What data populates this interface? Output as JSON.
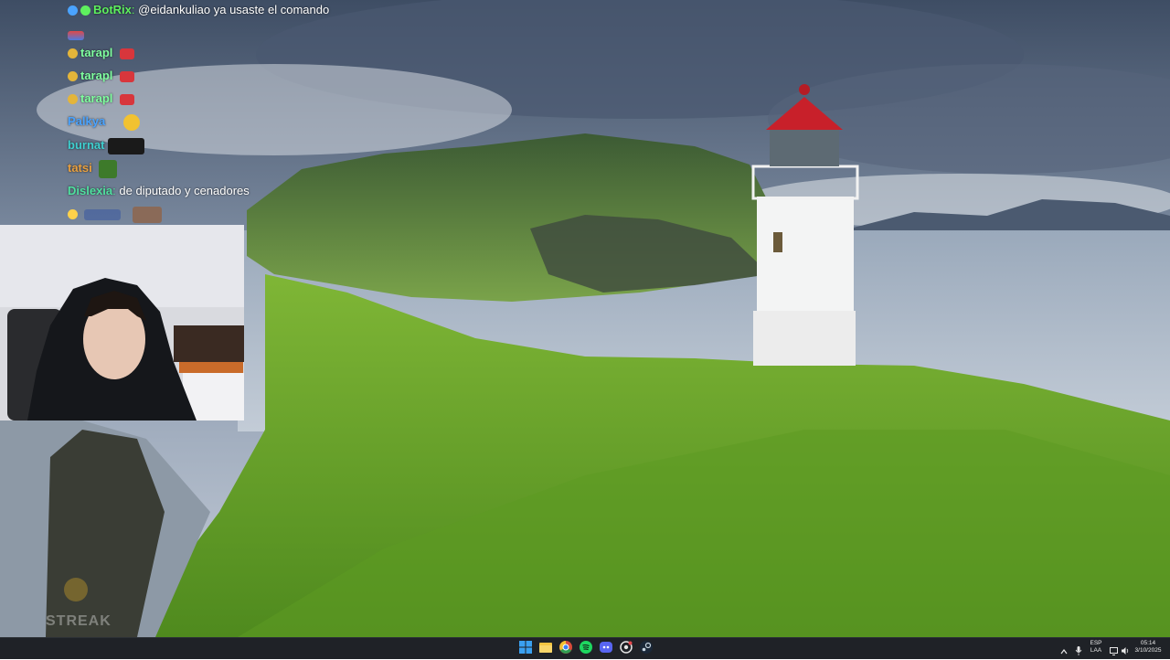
{
  "wallpaper": {
    "description_icon": "lighthouse-wallpaper"
  },
  "chat": {
    "lines": [
      {
        "user": "BotRix",
        "user_color": "#5ef05e",
        "message": "@eidankuliao ya usaste el comando",
        "badges": [
          "sword-icon",
          "check-badge-icon"
        ]
      },
      {
        "user": "",
        "user_color": "#ffffff",
        "message": "",
        "badges": [
          "flag-emote"
        ]
      },
      {
        "user": "tarapl",
        "user_color": "#7fff9f",
        "message": "",
        "badges": [
          "smile-emote"
        ]
      },
      {
        "user": "tarapl",
        "user_color": "#7fff9f",
        "message": "",
        "badges": [
          "smile-emote"
        ]
      },
      {
        "user": "tarapl",
        "user_color": "#7fff9f",
        "message": "",
        "badges": [
          "smile-emote"
        ]
      },
      {
        "user": "Palkya",
        "user_color": "#4aa3ff",
        "message": "",
        "badges": []
      },
      {
        "user": "burnat",
        "user_color": "#3fd0d0",
        "message": "",
        "badges": []
      },
      {
        "user": "tatsi",
        "user_color": "#e8a040",
        "message": "",
        "badges": []
      },
      {
        "user": "Dislexia",
        "user_color": "#50e0a0",
        "message": "de diputado y cenadores",
        "badges": []
      },
      {
        "user": "",
        "user_color": "#ffd24a",
        "message": "",
        "badges": [
          "crown-icon"
        ]
      }
    ]
  },
  "overlay": {
    "streak_label": "STREAK"
  },
  "taskbar": {
    "apps": [
      "windows-start-icon",
      "file-explorer-icon",
      "chrome-icon",
      "spotify-icon",
      "discord-icon",
      "github-icon",
      "steam-icon"
    ],
    "tray": {
      "lang_top": "ESP",
      "lang_bottom": "LAA",
      "time": "05:14",
      "date": "3/10/2025"
    }
  },
  "colors": {
    "taskbar_bg": "#1f2227",
    "lighthouse_roof": "#c8202a",
    "grass": "#6fa52a",
    "sea": "#b9c6d4"
  }
}
